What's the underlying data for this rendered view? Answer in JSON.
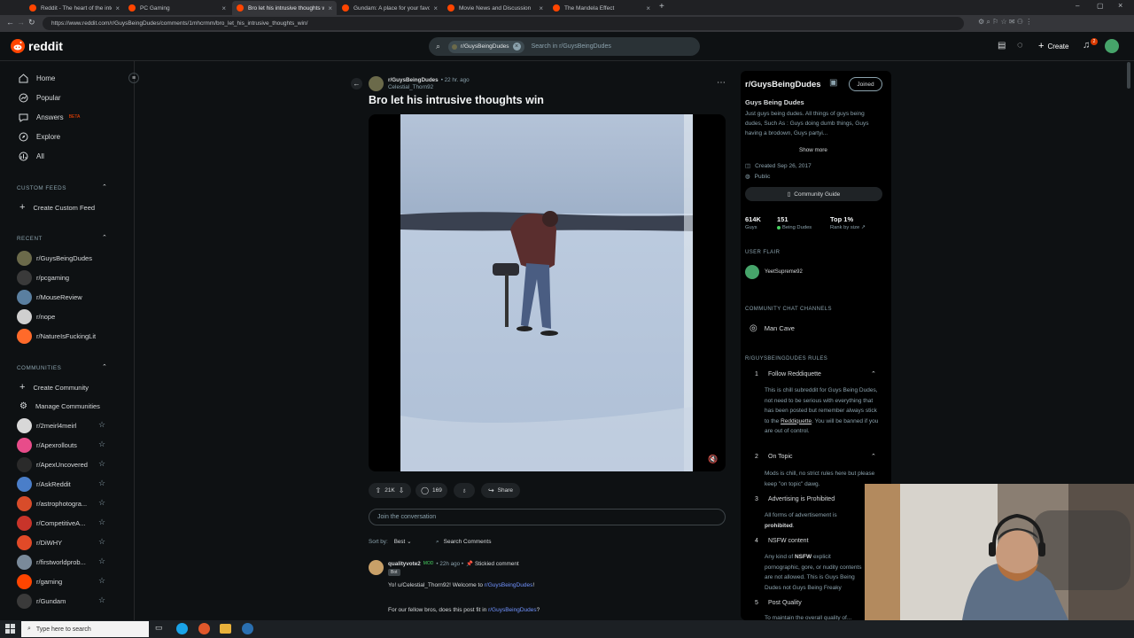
{
  "browser": {
    "tabs": [
      {
        "title": "Reddit - The heart of the internet"
      },
      {
        "title": "PC Gaming"
      },
      {
        "title": "Bro let his intrusive thoughts win"
      },
      {
        "title": "Gundam: A place for your favorite"
      },
      {
        "title": "Movie News and Discussion"
      },
      {
        "title": "The Mandela Effect"
      }
    ],
    "url": "https://www.reddit.com/r/GuysBeingDudes/comments/1mhcrmm/bro_let_his_intrusive_thoughts_win/"
  },
  "header": {
    "logo": "reddit",
    "search_chip": "r/GuysBeingDudes",
    "search_placeholder": "Search in r/GuysBeingDudes",
    "create_label": "Create",
    "notif_count": "2"
  },
  "sidebar": {
    "nav": [
      {
        "label": "Home"
      },
      {
        "label": "Popular"
      },
      {
        "label": "Answers",
        "badge": "BETA"
      },
      {
        "label": "Explore"
      },
      {
        "label": "All"
      }
    ],
    "custom_feeds_title": "CUSTOM FEEDS",
    "create_custom_feed": "Create Custom Feed",
    "recent_title": "RECENT",
    "recent": [
      "r/GuysBeingDudes",
      "r/pcgaming",
      "r/MouseReview",
      "r/nope",
      "r/NatureIsFuckingLit"
    ],
    "communities_title": "COMMUNITIES",
    "create_community": "Create Community",
    "manage_communities": "Manage Communities",
    "communities": [
      "r/2meirl4meirl",
      "r/Apexrollouts",
      "r/ApexUncovered",
      "r/AskReddit",
      "r/astrophotogra...",
      "r/CompetitiveA...",
      "r/DiWHY",
      "r/firstworldprob...",
      "r/gaming",
      "r/Gundam"
    ],
    "colors": {
      "recent": [
        "#6b6a4a",
        "#3a3a3a",
        "#5a7fa0",
        "#cfcfcf",
        "#ff6a2a"
      ],
      "communities": [
        "#d8d8d8",
        "#e84c8a",
        "#2a2a2a",
        "#4a7ec9",
        "#d84c2a",
        "#c8342a",
        "#e14a28",
        "#7a8a9a",
        "#ff4500",
        "#3a3a3a"
      ]
    }
  },
  "post": {
    "subreddit": "r/GuysBeingDudes",
    "time": "• 22 hr. ago",
    "author": "Celestial_Thorn92",
    "title": "Bro let his intrusive thoughts win",
    "votes": "21K",
    "comments": "169",
    "share_label": "Share",
    "join_placeholder": "Join the conversation",
    "sort_label": "Sort by:",
    "sort_value": "Best",
    "search_comments": "Search Comments"
  },
  "comment": {
    "author": "qualityvote2",
    "mod_tag": "MOD",
    "time": "• 22h ago •",
    "stickied": "Stickied comment",
    "bot_tag": "Bot",
    "line1_prefix": "Yo! u/Celestial_Thorn92! Welcome to ",
    "line1_link": "r/GuysBeingDudes",
    "line1_suffix": "!",
    "line2_prefix": "For our fellow bros, does this post fit in ",
    "line2_link": "r/GuysBeingDudes",
    "line2_suffix": "?"
  },
  "community": {
    "name": "r/GuysBeingDudes",
    "joined_label": "Joined",
    "display_name": "Guys Being Dudes",
    "description": "Just guys being dudes. All things of guys being dudes, Such As : Guys doing dumb things, Guys having a brodown, Guys partyi...",
    "show_more": "Show more",
    "created": "Created Sep 26, 2017",
    "visibility": "Public",
    "guide_label": "Community Guide",
    "members": "614K",
    "members_label": "Guys",
    "online": "151",
    "online_label": "Being Dudes",
    "rank": "Top 1%",
    "rank_label": "Rank by size",
    "user_flair_title": "USER FLAIR",
    "user_flair_name": "YeetSupreme92",
    "chat_title": "COMMUNITY CHAT CHANNELS",
    "chat_channel": "Man Cave",
    "rules_title": "R/GUYSBEINGDUDES RULES",
    "rules": [
      {
        "num": "1",
        "title": "Follow Reddiquette",
        "body": "This is chill subreddit for Guys Being Dudes, not need to be serious with everything that has been posted but remember always stick to the",
        "link": "Reddiquette",
        "body2": ". You will be banned if you are out of control."
      },
      {
        "num": "2",
        "title": "On Topic",
        "body": "Mods is chill, no strict rules here but please keep \"on topic\" dawg."
      },
      {
        "num": "3",
        "title": "Advertising is Prohibited",
        "body": "All forms of advertisement is",
        "bold": "prohibited",
        "body2": "."
      },
      {
        "num": "4",
        "title": "NSFW content",
        "body": "Any kind of",
        "bold": "NSFW",
        "body2": "explicit pornographic, gore, or nudity contents are not allowed. This is Guys Being Dudes not Guys Being Freaky"
      },
      {
        "num": "5",
        "title": "Post Quality",
        "body": "To maintain the overall quality of..."
      }
    ]
  },
  "taskbar": {
    "search_placeholder": "Type here to search"
  }
}
